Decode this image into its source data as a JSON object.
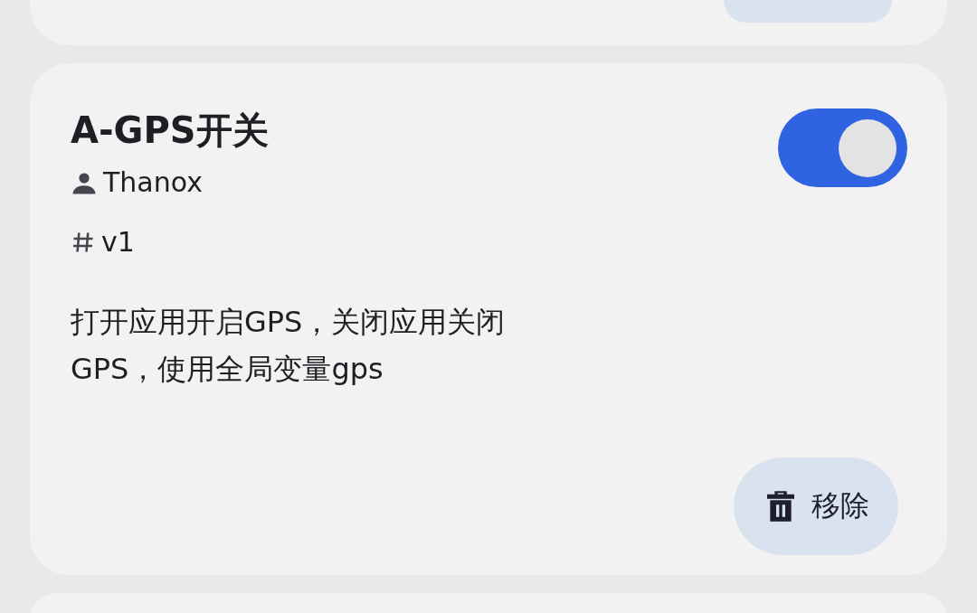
{
  "rule": {
    "title": "A-GPS开关",
    "author": "Thanox",
    "version": "v1",
    "description": "打开应用开启GPS，关闭应用关闭GPS，使用全局变量gps",
    "enabled": true,
    "remove_button": {
      "label": "移除"
    }
  }
}
